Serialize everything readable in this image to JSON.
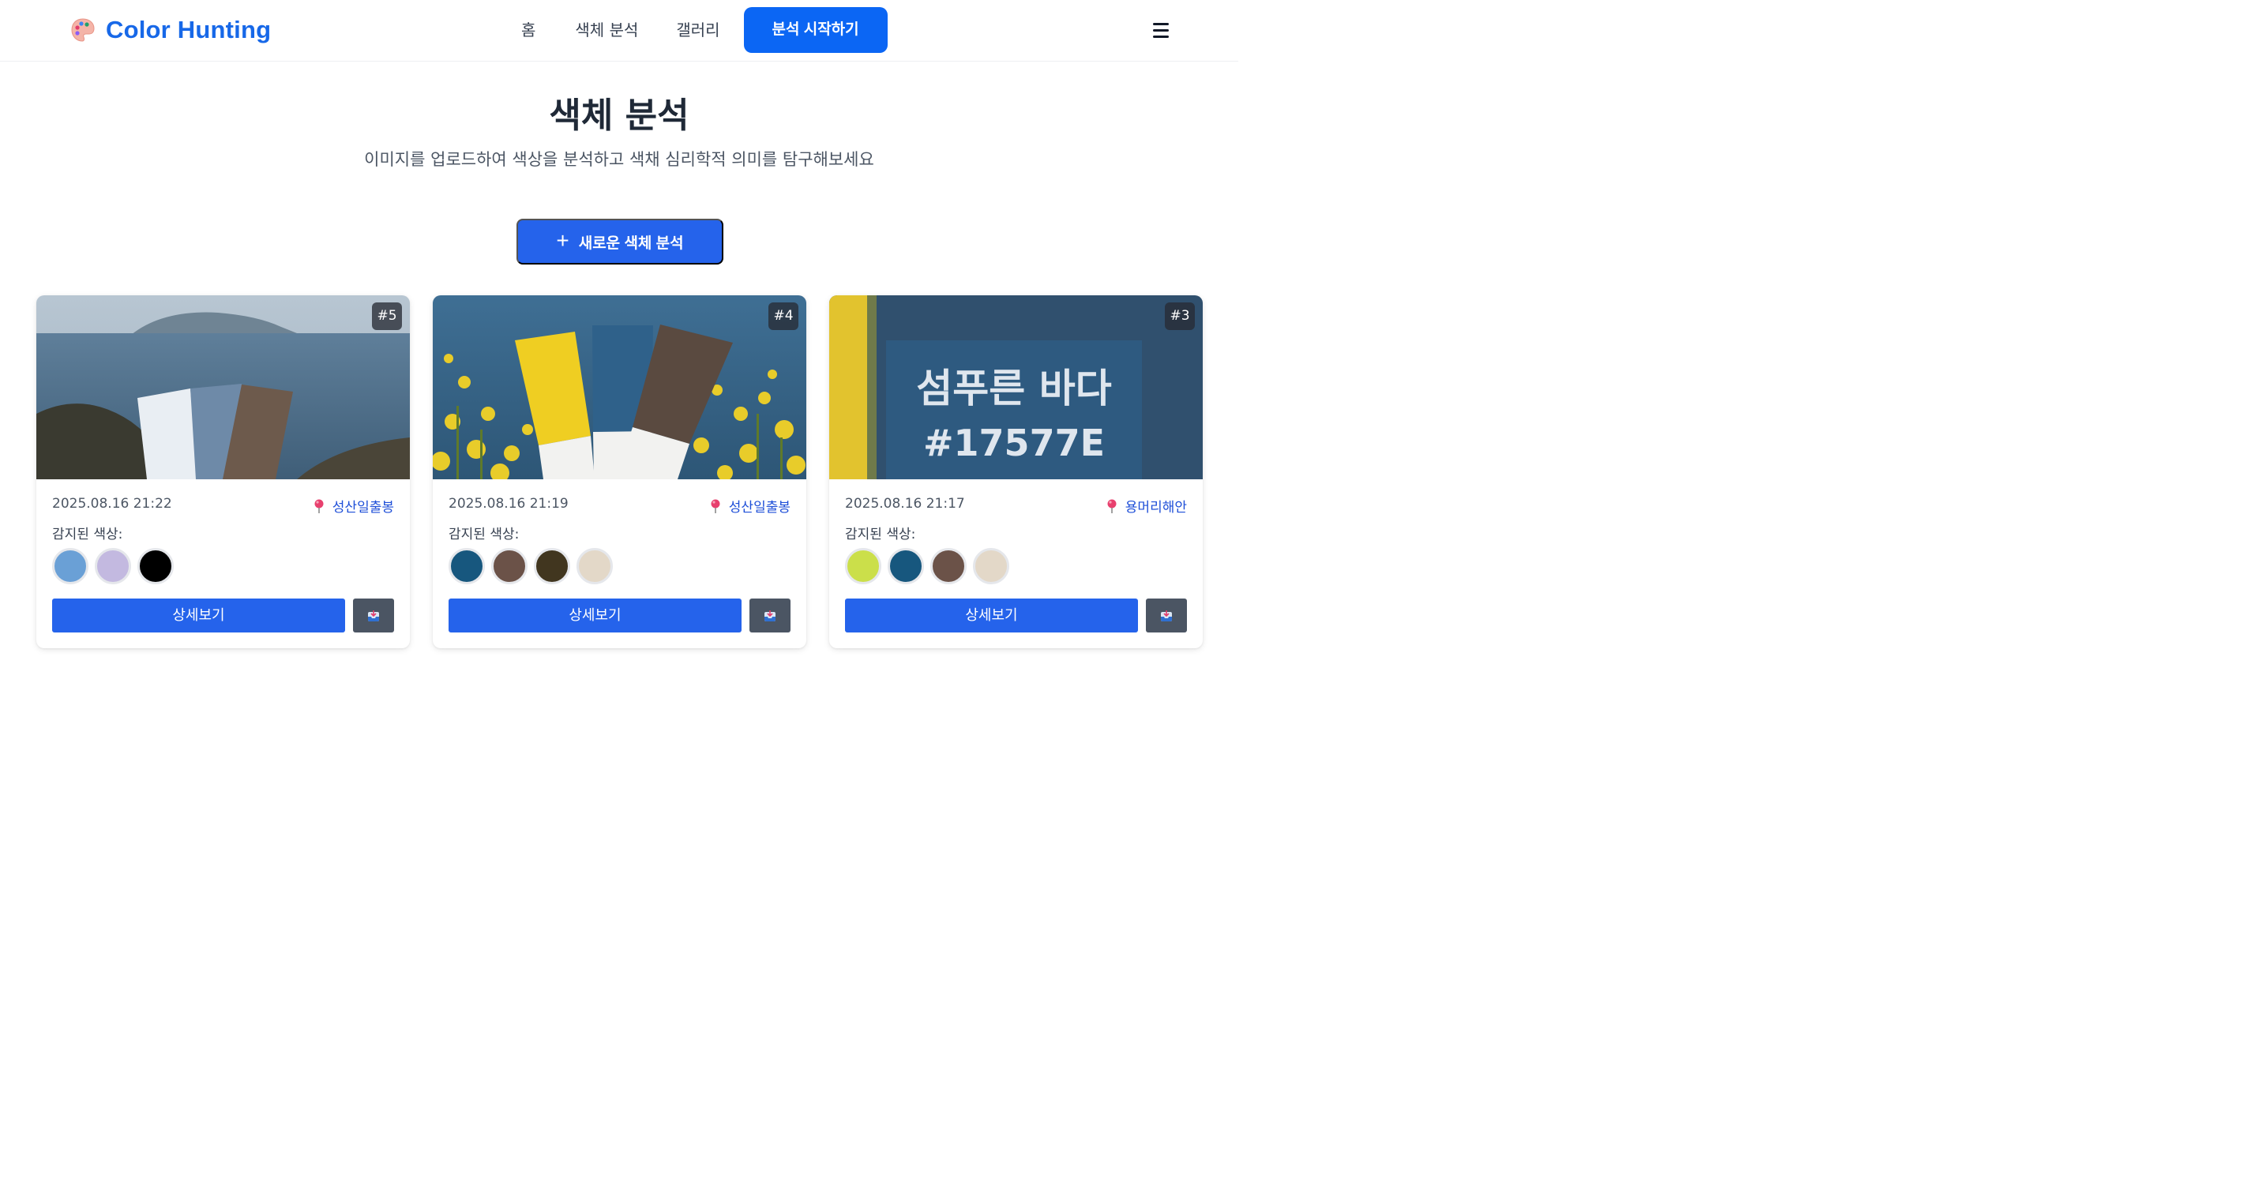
{
  "app": {
    "name": "Color Hunting"
  },
  "nav": {
    "links": [
      "홈",
      "색체 분석",
      "갤러리"
    ],
    "cta": "분석 시작하기"
  },
  "hero": {
    "title": "색체 분석",
    "subtitle": "이미지를 업로드하여 색상을 분석하고 색채 심리학적 의미를 탐구해보세요",
    "new_button": "새로운 색체 분석"
  },
  "cards": [
    {
      "badge": "#5",
      "date": "2025.08.16 21:22",
      "location": "성산일출봉",
      "detected_label": "감지된 색상:",
      "colors": [
        "#6aa0d6",
        "#c3b9e0",
        "#000000"
      ],
      "detail_button": "상세보기"
    },
    {
      "badge": "#4",
      "date": "2025.08.16 21:19",
      "location": "성산일출봉",
      "detected_label": "감지된 색상:",
      "colors": [
        "#17577e",
        "#6b5248",
        "#41361f",
        "#e3d8c8"
      ],
      "detail_button": "상세보기"
    },
    {
      "badge": "#3",
      "date": "2025.08.16 21:17",
      "location": "용머리해안",
      "detected_label": "감지된 색상:",
      "colors": [
        "#cbdf4a",
        "#17577e",
        "#6b5248",
        "#e3d8c8"
      ],
      "detail_button": "상세보기",
      "image_text": {
        "title": "섬푸른 바다",
        "code": "#17577E"
      }
    }
  ],
  "icons": {
    "logo": "palette-icon",
    "menu": "hamburger-menu-icon",
    "add": "plus-icon",
    "location": "map-pin-icon",
    "share": "share-inbox-icon"
  },
  "accent_colors": {
    "primary": "#2563eb",
    "brand": "#1768e8",
    "cta": "#0b66f4",
    "secondary": "#4b5563"
  }
}
